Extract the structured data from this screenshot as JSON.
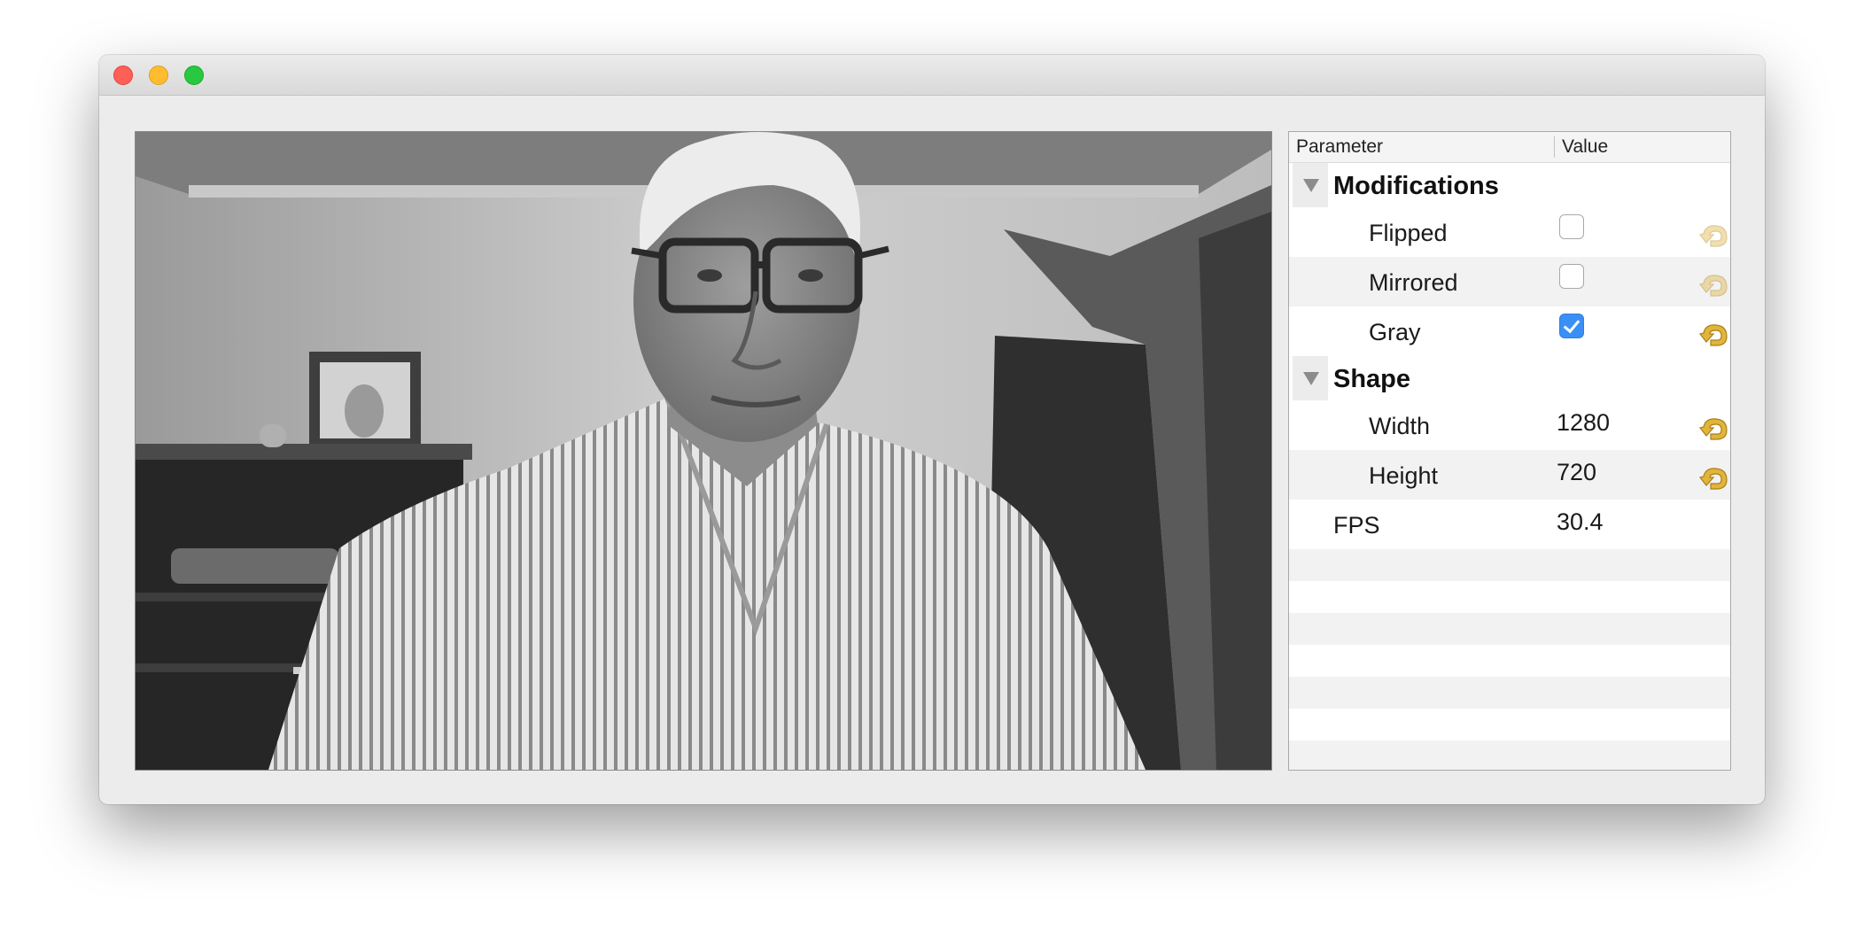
{
  "window": {
    "controls": [
      "close-button",
      "minimize-button",
      "zoom-button"
    ]
  },
  "video": {
    "mode": "grayscale camera feed",
    "icon": "camera-preview"
  },
  "table": {
    "headers": {
      "parameter": "Parameter",
      "value": "Value"
    },
    "groups": [
      {
        "title": "Modifications",
        "rows": [
          {
            "label": "Flipped",
            "type": "checkbox",
            "checked": false,
            "reset_enabled": false
          },
          {
            "label": "Mirrored",
            "type": "checkbox",
            "checked": false,
            "reset_enabled": false
          },
          {
            "label": "Gray",
            "type": "checkbox",
            "checked": true,
            "reset_enabled": true
          }
        ]
      },
      {
        "title": "Shape",
        "rows": [
          {
            "label": "Width",
            "type": "text",
            "value": "1280",
            "reset_enabled": true
          },
          {
            "label": "Height",
            "type": "text",
            "value": "720",
            "reset_enabled": true
          }
        ]
      }
    ],
    "fps": {
      "label": "FPS",
      "value": "30.4"
    },
    "colors": {
      "checkbox_accent": "#3a8ff6",
      "reset_icon": "#e2b43a"
    }
  }
}
